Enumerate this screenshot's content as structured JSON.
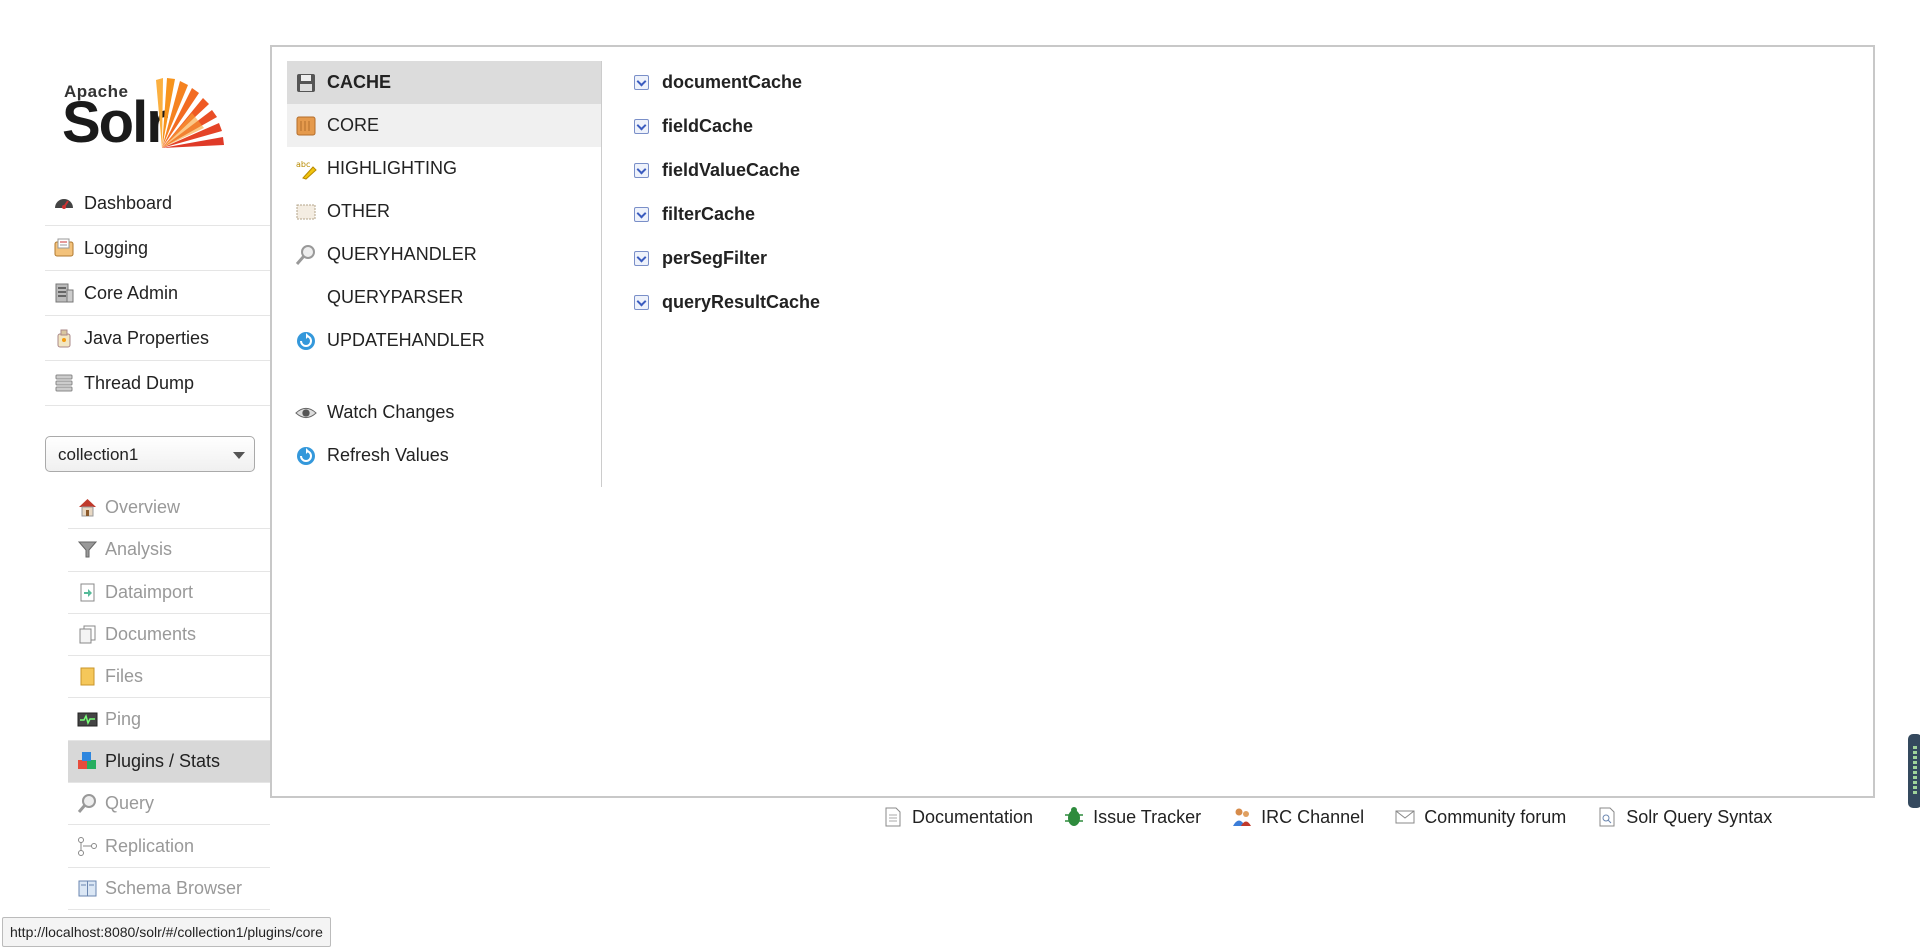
{
  "logo": {
    "apache": "Apache",
    "solr": "Solr"
  },
  "main_nav": [
    {
      "label": "Dashboard",
      "icon": "dashboard-icon"
    },
    {
      "label": "Logging",
      "icon": "logging-icon"
    },
    {
      "label": "Core Admin",
      "icon": "core-admin-icon"
    },
    {
      "label": "Java Properties",
      "icon": "java-properties-icon"
    },
    {
      "label": "Thread Dump",
      "icon": "thread-dump-icon"
    }
  ],
  "core_selector": {
    "value": "collection1"
  },
  "core_menu": [
    {
      "label": "Overview",
      "icon": "home-icon"
    },
    {
      "label": "Analysis",
      "icon": "funnel-icon"
    },
    {
      "label": "Dataimport",
      "icon": "dataimport-icon"
    },
    {
      "label": "Documents",
      "icon": "documents-icon"
    },
    {
      "label": "Files",
      "icon": "folder-icon"
    },
    {
      "label": "Ping",
      "icon": "ping-icon"
    },
    {
      "label": "Plugins / Stats",
      "icon": "plugins-icon"
    },
    {
      "label": "Query",
      "icon": "magnifier-icon"
    },
    {
      "label": "Replication",
      "icon": "replication-icon"
    },
    {
      "label": "Schema Browser",
      "icon": "schema-icon"
    }
  ],
  "types": [
    {
      "label": "CACHE",
      "icon": "floppy-disk-icon"
    },
    {
      "label": "CORE",
      "icon": "core-box-icon"
    },
    {
      "label": "HIGHLIGHTING",
      "icon": "highlighter-icon"
    },
    {
      "label": "OTHER",
      "icon": "other-icon"
    },
    {
      "label": "QUERYHANDLER",
      "icon": "magnifier-icon"
    },
    {
      "label": "QUERYPARSER",
      "icon": ""
    },
    {
      "label": "UPDATEHANDLER",
      "icon": "refresh-icon"
    }
  ],
  "actions": [
    {
      "label": "Watch Changes",
      "icon": "eye-icon"
    },
    {
      "label": "Refresh Values",
      "icon": "refresh-icon"
    }
  ],
  "entries": [
    "documentCache",
    "fieldCache",
    "fieldValueCache",
    "filterCache",
    "perSegFilter",
    "queryResultCache"
  ],
  "footer": [
    {
      "label": "Documentation",
      "icon": "document-icon"
    },
    {
      "label": "Issue Tracker",
      "icon": "bug-icon"
    },
    {
      "label": "IRC Channel",
      "icon": "people-icon"
    },
    {
      "label": "Community forum",
      "icon": "mail-icon"
    },
    {
      "label": "Solr Query Syntax",
      "icon": "query-syntax-icon"
    }
  ],
  "status_bar": {
    "url": "http://localhost:8080/solr/#/collection1/plugins/core"
  },
  "colors": {
    "selected_bg": "#dcdcdc",
    "hover_bg": "#f0f0f0",
    "frame_border": "#c8c8c8",
    "inactive_text": "#999999",
    "solr_orange": "#e8552d"
  }
}
